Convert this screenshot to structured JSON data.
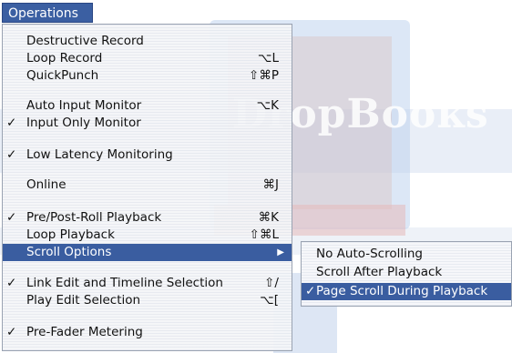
{
  "menu": {
    "title": "Operations",
    "items": [
      {
        "label": "Destructive Record",
        "shortcut": "",
        "checked": false
      },
      {
        "label": "Loop Record",
        "shortcut": "⌥L",
        "checked": false
      },
      {
        "label": "QuickPunch",
        "shortcut": "⇧⌘P",
        "checked": false
      },
      {
        "label": "Auto Input Monitor",
        "shortcut": "⌥K",
        "checked": false
      },
      {
        "label": "Input Only Monitor",
        "shortcut": "",
        "checked": true
      },
      {
        "label": "Low Latency Monitoring",
        "shortcut": "",
        "checked": true
      },
      {
        "label": "Online",
        "shortcut": "⌘J",
        "checked": false
      },
      {
        "label": "Pre/Post-Roll Playback",
        "shortcut": "⌘K",
        "checked": true
      },
      {
        "label": "Loop Playback",
        "shortcut": "⇧⌘L",
        "checked": false
      },
      {
        "label": "Scroll Options",
        "shortcut": "",
        "checked": false,
        "submenu": true
      },
      {
        "label": "Link Edit and Timeline Selection",
        "shortcut": "⇧/",
        "checked": true
      },
      {
        "label": "Play Edit Selection",
        "shortcut": "⌥[",
        "checked": false
      },
      {
        "label": "Pre-Fader Metering",
        "shortcut": "",
        "checked": true
      }
    ],
    "check_glyph": "✓",
    "submenu_arrow": "▶"
  },
  "submenu": {
    "items": [
      {
        "label": "No Auto-Scrolling",
        "checked": false
      },
      {
        "label": "Scroll After Playback",
        "checked": false
      },
      {
        "label": "Page Scroll During Playback",
        "checked": true
      }
    ]
  },
  "watermark": {
    "text": "DropBooks"
  },
  "colors": {
    "highlight": "#3a5da0",
    "title_bg": "#3b5fa2"
  }
}
